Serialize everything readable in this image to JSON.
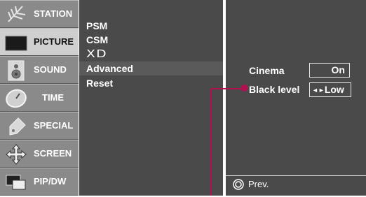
{
  "sidebar": {
    "items": [
      {
        "label": "STATION",
        "icon": "antenna-icon"
      },
      {
        "label": "PICTURE",
        "icon": "monitor-icon",
        "active": true
      },
      {
        "label": "SOUND",
        "icon": "speaker-icon"
      },
      {
        "label": "TIME",
        "icon": "clock-icon"
      },
      {
        "label": "SPECIAL",
        "icon": "tag-icon"
      },
      {
        "label": "SCREEN",
        "icon": "move-arrows-icon"
      },
      {
        "label": "PIP/DW",
        "icon": "pip-windows-icon"
      }
    ]
  },
  "menu": {
    "items": [
      "PSM",
      "CSM",
      "XD",
      "Advanced",
      "Reset"
    ],
    "selected": "Advanced"
  },
  "options": {
    "cinema_label": "Cinema",
    "cinema_value": "On",
    "black_level_label": "Black level",
    "black_level_arrows": "◄►",
    "black_level_value": "Low"
  },
  "footer": {
    "prev_label": "Prev."
  },
  "colors": {
    "sidebar_bg": "#8a8a8a",
    "panel_bg": "#4a4a4a",
    "callout": "#b0104f"
  }
}
